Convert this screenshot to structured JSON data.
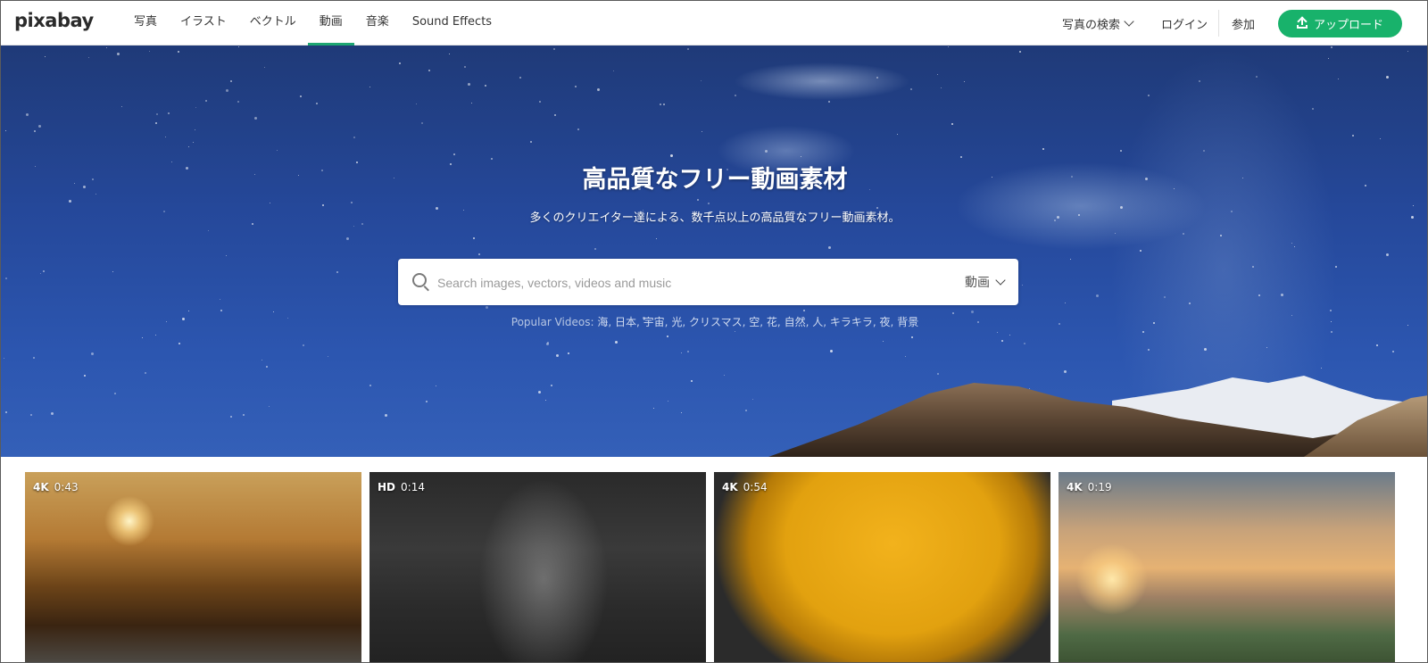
{
  "header": {
    "logo": "pixabay",
    "nav": [
      {
        "label": "写真",
        "active": false
      },
      {
        "label": "イラスト",
        "active": false
      },
      {
        "label": "ベクトル",
        "active": false
      },
      {
        "label": "動画",
        "active": true
      },
      {
        "label": "音楽",
        "active": false
      },
      {
        "label": "Sound Effects",
        "active": false
      }
    ],
    "explore_label": "写真の検索",
    "login_label": "ログイン",
    "join_label": "参加",
    "upload_label": "アップロード"
  },
  "hero": {
    "title": "高品質なフリー動画素材",
    "subtitle": "多くのクリエイター達による、数千点以上の高品質なフリー動画素材。",
    "search": {
      "placeholder": "Search images, vectors, videos and music",
      "type_label": "動画"
    },
    "popular": {
      "label": "Popular Videos:",
      "tags": [
        "海",
        "日本",
        "宇宙",
        "光",
        "クリスマス",
        "空",
        "花",
        "自然",
        "人",
        "キラキラ",
        "夜",
        "背景"
      ]
    }
  },
  "thumbnails": [
    {
      "quality": "4K",
      "duration": "0:43"
    },
    {
      "quality": "HD",
      "duration": "0:14"
    },
    {
      "quality": "4K",
      "duration": "0:54"
    },
    {
      "quality": "4K",
      "duration": "0:19"
    }
  ],
  "colors": {
    "accent": "#18b26b",
    "active_underline": "#1ea672",
    "sky": "#25489a"
  }
}
